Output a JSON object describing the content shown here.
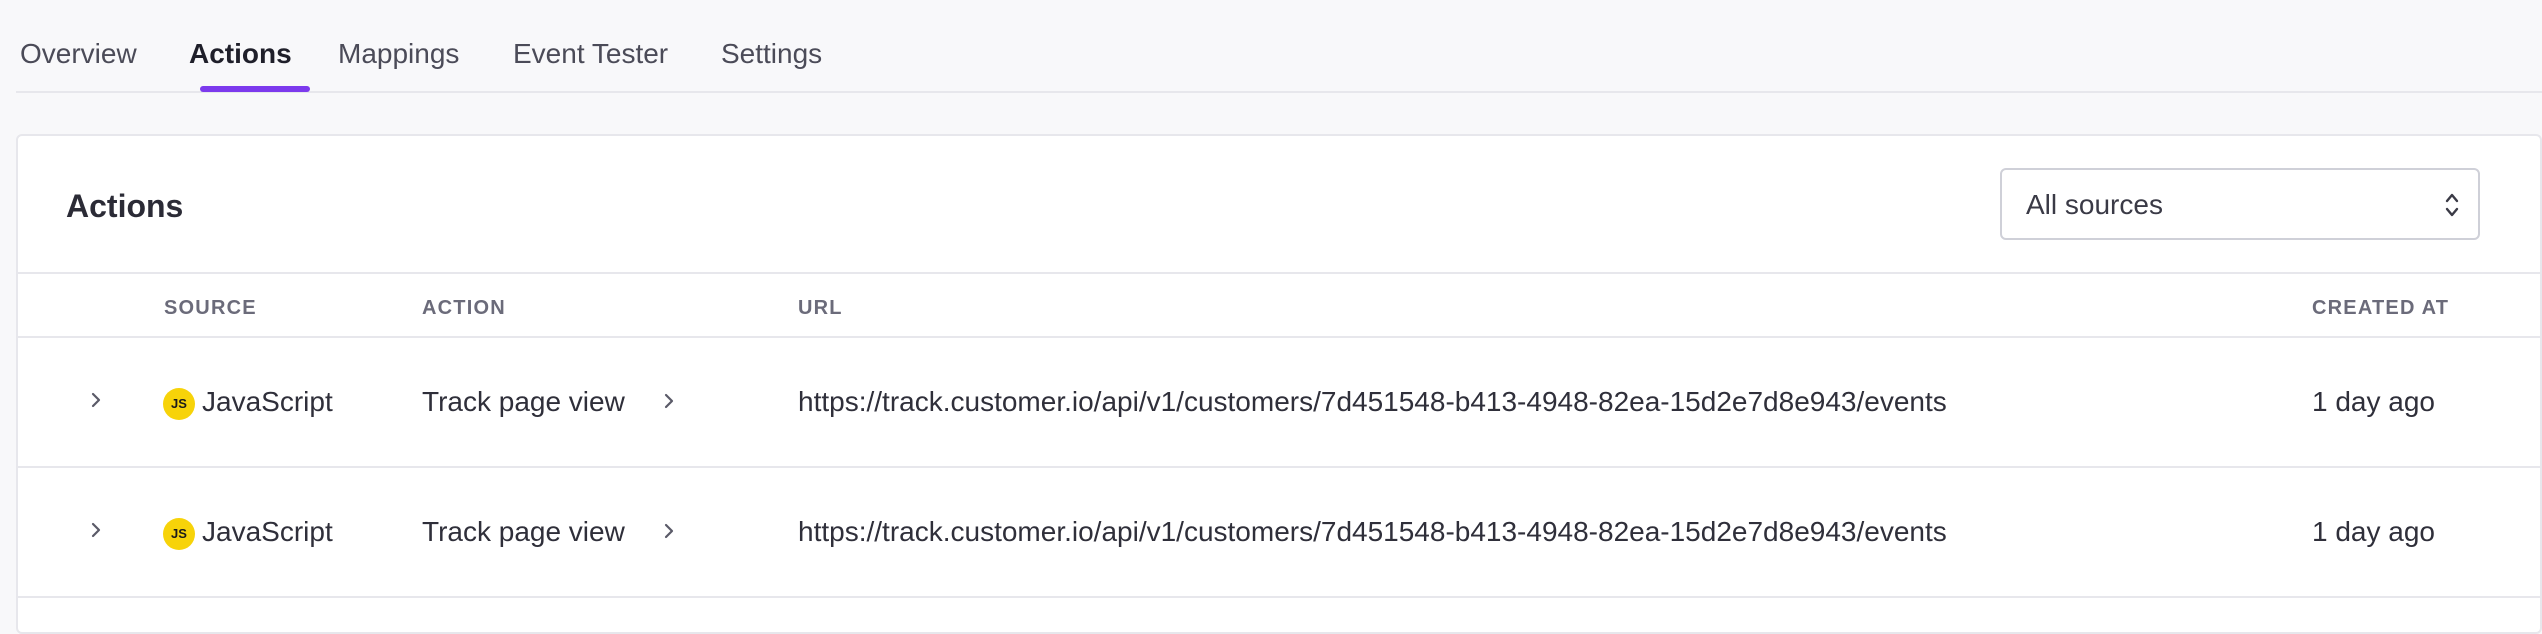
{
  "tabs": [
    {
      "label": "Overview"
    },
    {
      "label": "Actions"
    },
    {
      "label": "Mappings"
    },
    {
      "label": "Event Tester"
    },
    {
      "label": "Settings"
    }
  ],
  "active_tab": "Actions",
  "accent_color": "#7c3aed",
  "card": {
    "title": "Actions",
    "source_filter": {
      "selected": "All sources",
      "icon": "updown-chevron-icon"
    }
  },
  "table": {
    "columns": [
      "SOURCE",
      "ACTION",
      "URL",
      "CREATED AT"
    ],
    "rows": [
      {
        "source": {
          "badge": "JS",
          "label": "JavaScript",
          "badge_color": "#f7d309"
        },
        "action": "Track page view",
        "url": "https://track.customer.io/api/v1/customers/7d451548-b413-4948-82ea-15d2e7d8e943/events",
        "created_at": "1 day ago"
      },
      {
        "source": {
          "badge": "JS",
          "label": "JavaScript",
          "badge_color": "#f7d309"
        },
        "action": "Track page view",
        "url": "https://track.customer.io/api/v1/customers/7d451548-b413-4948-82ea-15d2e7d8e943/events",
        "created_at": "1 day ago"
      }
    ]
  }
}
